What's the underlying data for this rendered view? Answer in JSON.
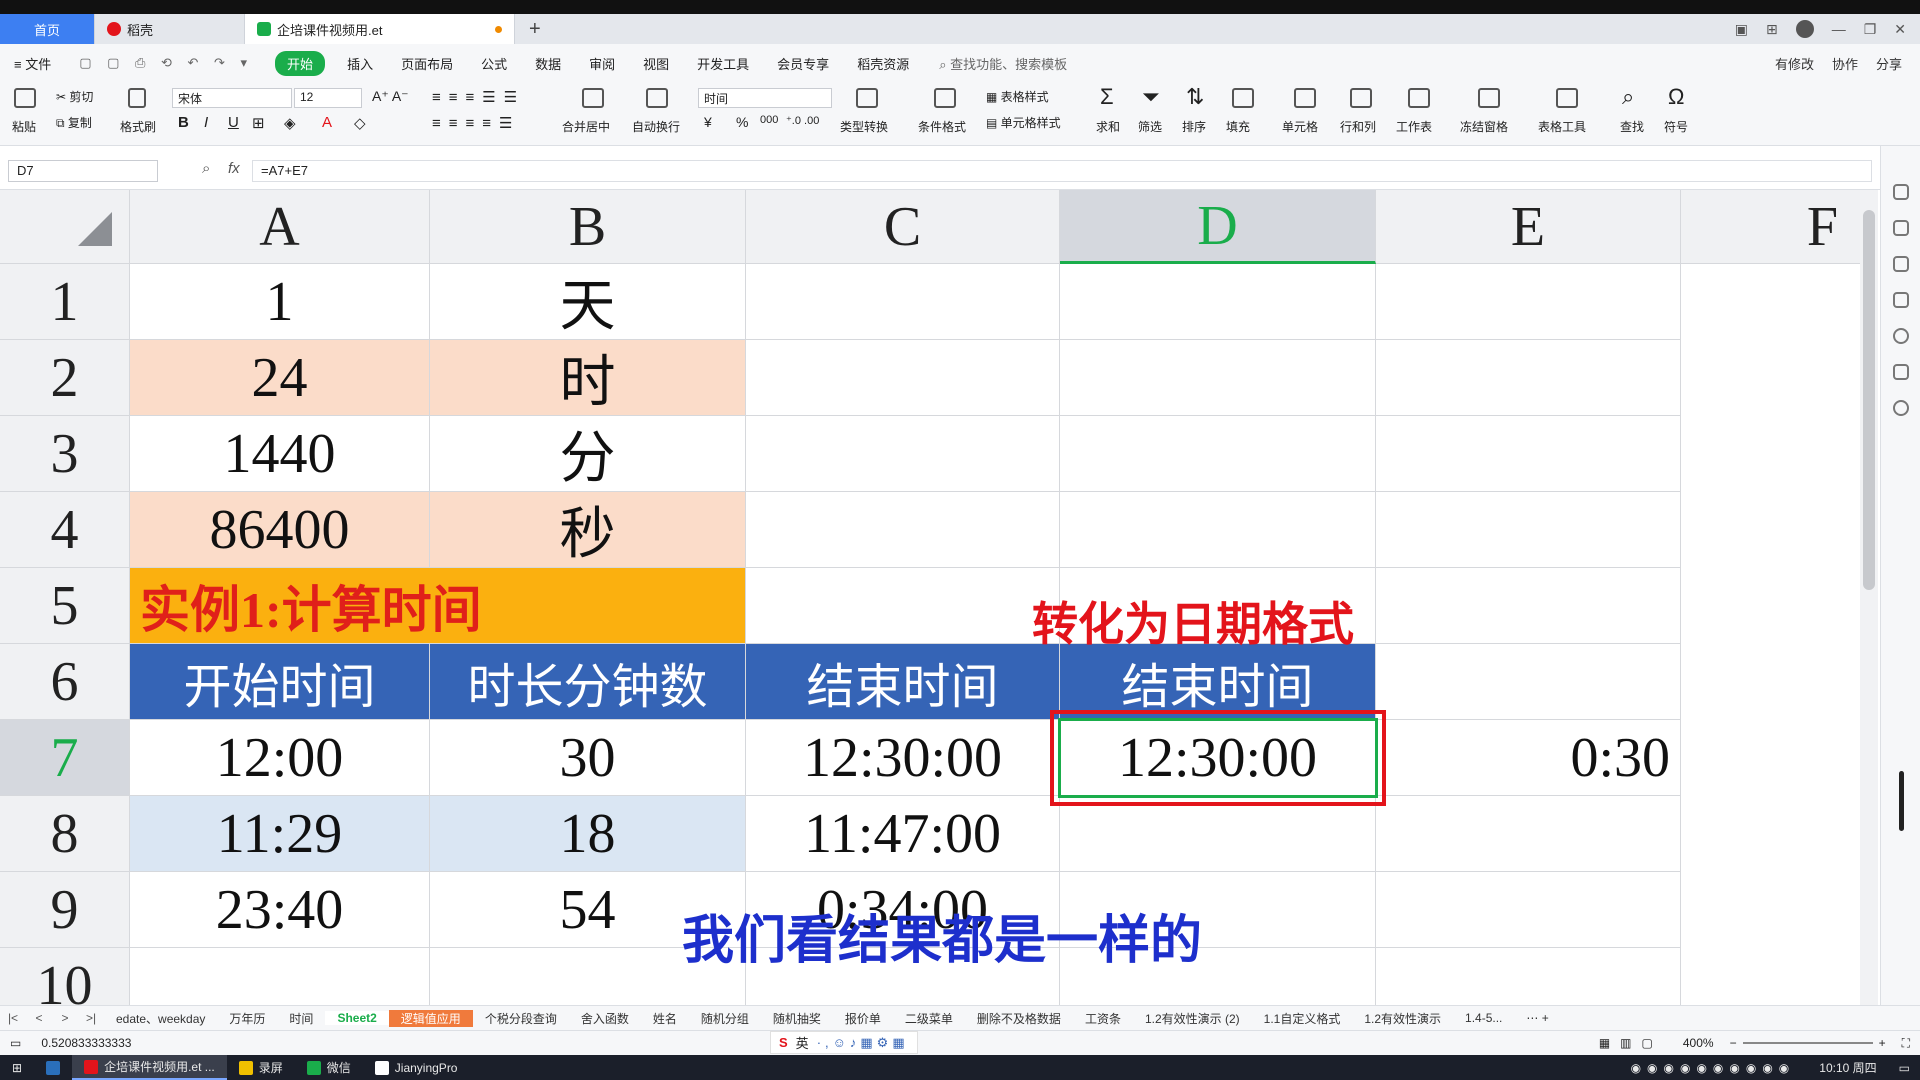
{
  "tabbar": {
    "home": "首页",
    "tab1": "稻壳",
    "tab2": "企培课件视频用.et",
    "plus": "+"
  },
  "menu": {
    "file": "≡ 文件",
    "items": [
      "开始",
      "插入",
      "页面布局",
      "公式",
      "数据",
      "审阅",
      "视图",
      "开发工具",
      "会员专享",
      "稻壳资源"
    ],
    "search": "查找功能、搜索模板",
    "right": [
      "有修改",
      "协作",
      "分享"
    ]
  },
  "ribbon": {
    "cut": "剪切",
    "copy": "复制",
    "paste": "粘贴",
    "format_painter": "格式刷",
    "font_name": "宋体",
    "font_size": "12",
    "merge": "合并居中",
    "wrap": "自动换行",
    "number_format": "时间",
    "type_convert": "类型转换",
    "cond_format": "条件格式",
    "table_style": "表格样式",
    "cell_style": "单元格样式",
    "sum": "求和",
    "filter": "筛选",
    "sort": "排序",
    "fill": "填充",
    "cell": "单元格",
    "rowcol": "行和列",
    "worksheet": "工作表",
    "freeze": "冻结窗格",
    "table_tools": "表格工具",
    "find": "查找",
    "symbol": "符号",
    "bold": "B",
    "italic": "I",
    "underline": "U",
    "font_color": "A",
    "percent": "%",
    "currency": "¥",
    "thousands": "000"
  },
  "formula_bar": {
    "cell_ref": "D7",
    "fx": "fx",
    "formula": "=A7+E7"
  },
  "columns": [
    "A",
    "B",
    "C",
    "D",
    "E",
    "F"
  ],
  "rows": [
    "1",
    "2",
    "3",
    "4",
    "5",
    "6",
    "7",
    "8",
    "9",
    "10"
  ],
  "cells": {
    "A1": "1",
    "B1": "天",
    "A2": "24",
    "B2": "时",
    "A3": "1440",
    "B3": "分",
    "A4": "86400",
    "B4": "秒",
    "A5": "实例1:计算时间",
    "A6": "开始时间",
    "B6": "时长分钟数",
    "C6": "结束时间",
    "D6": "结束时间",
    "A7": "12:00",
    "B7": "30",
    "C7": "12:30:00",
    "D7": "12:30:00",
    "E7": "0:30",
    "A8": "11:29",
    "B8": "18",
    "C8": "11:47:00",
    "A9": "23:40",
    "B9": "54",
    "C9": "0:34:00"
  },
  "annotations": {
    "red_label": "转化为日期格式",
    "subtitle": "我们看结果都是一样的"
  },
  "sheet_tabs": [
    "edate、weekday",
    "万年历",
    "时间",
    "Sheet2",
    "逻辑值应用",
    "个税分段查询",
    "舍入函数",
    "姓名",
    "随机分组",
    "随机抽奖",
    "报价单",
    "二级菜单",
    "删除不及格数据",
    "工资条",
    "1.2有效性演示 (2)",
    "1.1自定义格式",
    "1.2有效性演示",
    "1.4-5..."
  ],
  "active_sheet": "Sheet2",
  "status": {
    "value": "0.520833333333",
    "zoom": "400%",
    "ime_lang": "英"
  },
  "taskbar": {
    "items": [
      "企培课件视频用.et ...",
      "录屏",
      "微信",
      "JianyingPro"
    ],
    "time": "10:10 周四"
  },
  "colors": {
    "accent_green": "#1aad4b",
    "header_blue": "#3564b6",
    "title_orange": "#fbb00f",
    "peach": "#fbdcc9",
    "light_blue": "#dae6f3",
    "annot_red": "#e3141b",
    "subtitle_blue": "#1d2fcc"
  }
}
